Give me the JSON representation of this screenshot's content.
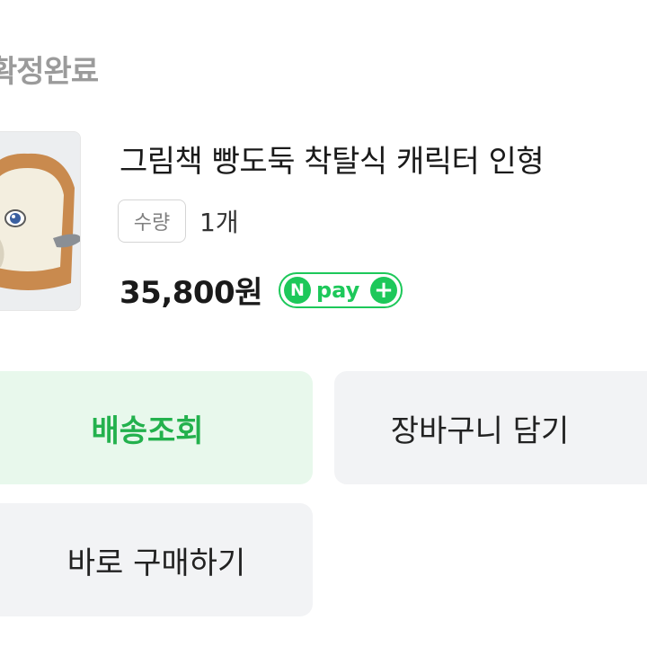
{
  "order": {
    "status": "확정완료"
  },
  "product": {
    "title": "그림책 빵도둑 착탈식 캐릭터 인형",
    "quantity_label": "수량",
    "quantity_value": "1개",
    "price": "35,800원"
  },
  "payment": {
    "npay_n": "N",
    "npay_text": "pay",
    "npay_plus": "+"
  },
  "actions": {
    "track_label": "배송조회",
    "cart_label": "장바구니 담기",
    "buy_label": "바로 구매하기"
  },
  "colors": {
    "brand_green": "#1dc85a",
    "track_bg": "#e8f8ec",
    "track_text": "#23b14d",
    "button_gray": "#f2f3f5"
  }
}
